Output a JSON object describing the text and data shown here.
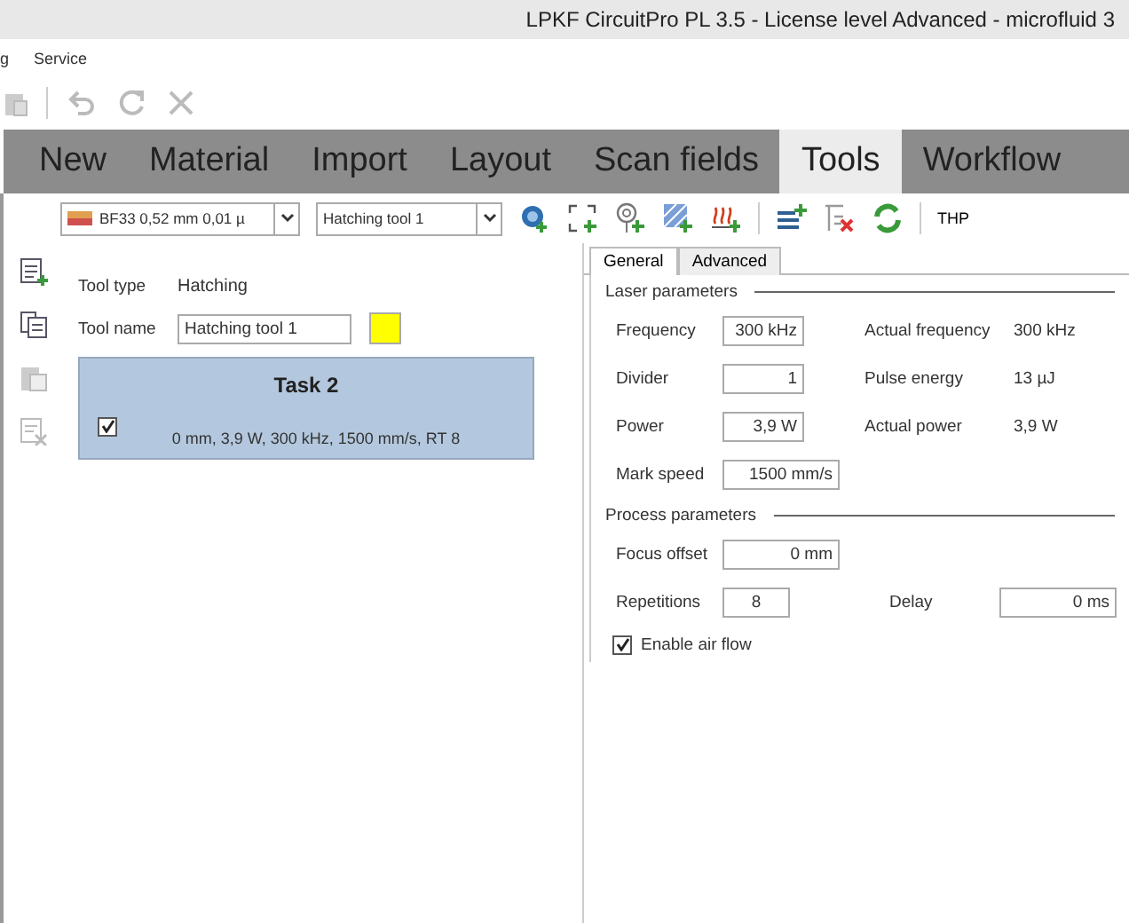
{
  "window": {
    "title": "LPKF CircuitPro PL 3.5 - License level Advanced - microfluid 3"
  },
  "menu": [
    "g",
    "Service"
  ],
  "ribbon_tabs": [
    {
      "label": "New",
      "selected": false
    },
    {
      "label": "Material",
      "selected": false
    },
    {
      "label": "Import",
      "selected": false
    },
    {
      "label": "Layout",
      "selected": false
    },
    {
      "label": "Scan fields",
      "selected": false
    },
    {
      "label": "Tools",
      "selected": true
    },
    {
      "label": "Workflow",
      "selected": false
    }
  ],
  "toolbar": {
    "material": "BF33 0,52 mm 0,01 µ",
    "tool": "Hatching tool 1",
    "thp": "THP"
  },
  "tool": {
    "type_label": "Tool type",
    "type_value": "Hatching",
    "name_label": "Tool name",
    "name_value": "Hatching tool 1",
    "color": "#ffff00"
  },
  "tasks": [
    {
      "title": "Task 2",
      "summary": "0 mm, 3,9 W, 300 kHz, 1500 mm/s, RT 8",
      "checked": true,
      "selected": true
    }
  ],
  "param_tabs": [
    {
      "label": "General",
      "selected": true
    },
    {
      "label": "Advanced",
      "selected": false
    }
  ],
  "laser": {
    "heading": "Laser parameters",
    "fields": [
      {
        "label": "Frequency",
        "value": "300 kHz",
        "info_label": "Actual frequency",
        "info_value": "300 kHz"
      },
      {
        "label": "Divider",
        "value": "1",
        "info_label": "Pulse energy",
        "info_value": "13 µJ"
      },
      {
        "label": "Power",
        "value": "3,9 W",
        "info_label": "Actual power",
        "info_value": "3,9 W"
      },
      {
        "label": "Mark speed",
        "value": "1500 mm/s"
      }
    ]
  },
  "process": {
    "heading": "Process parameters",
    "focus_label": "Focus offset",
    "focus_value": "0 mm",
    "rep_label": "Repetitions",
    "rep_value": "8",
    "delay_label": "Delay",
    "delay_value": "0 ms"
  },
  "air_flow": {
    "label": "Enable air flow",
    "checked": true
  }
}
